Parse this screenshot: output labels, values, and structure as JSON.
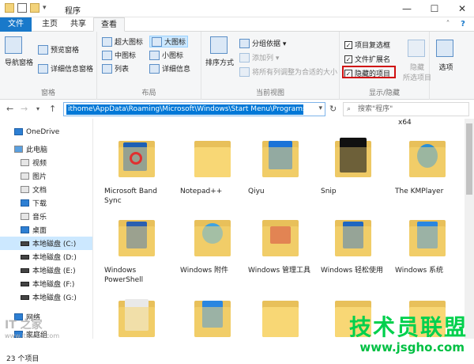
{
  "window": {
    "title": "程序",
    "minimize": "—",
    "maximize": "☐",
    "close": "✕",
    "help": "?"
  },
  "tabs": {
    "file": "文件",
    "home": "主页",
    "share": "共享",
    "view": "查看"
  },
  "ribbon": {
    "panes": {
      "nav_pane": "导航窗格",
      "preview": "预览窗格",
      "details": "详细信息窗格",
      "label": "窗格"
    },
    "layout": {
      "xlarge": "超大图标",
      "large": "大图标",
      "medium": "中图标",
      "small": "小图标",
      "list": "列表",
      "details": "详细信息",
      "label": "布局"
    },
    "current_view": {
      "sort": "排序方式",
      "group": "分组依据 ▾",
      "add_col": "添加列 ▾",
      "fit_cols": "将所有列调整为合适的大小",
      "label": "当前视图"
    },
    "show_hide": {
      "item_checkboxes": "项目复选框",
      "file_ext": "文件扩展名",
      "hidden_items": "隐藏的项目",
      "hide": "隐藏",
      "hide_selected": "所选项目",
      "label": "显示/隐藏",
      "options": "选项"
    }
  },
  "address": {
    "path": "ithome\\AppData\\Roaming\\Microsoft\\Windows\\Start Menu\\Programs",
    "search_placeholder": "搜索\"程序\""
  },
  "nav_pane": {
    "items": [
      "OneDrive",
      "此电脑",
      "视频",
      "图片",
      "文档",
      "下载",
      "音乐",
      "桌面",
      "本地磁盘 (C:)",
      "本地磁盘 (D:)",
      "本地磁盘 (E:)",
      "本地磁盘 (F:)",
      "本地磁盘 (G:)",
      "网络",
      "家庭组"
    ]
  },
  "folders": {
    "x64_label": "x64",
    "items": [
      "Microsoft Band Sync",
      "Notepad++",
      "Qiyu",
      "Snip",
      "The KMPlayer",
      "Windows PowerShell",
      "Windows 附件",
      "Windows 管理工具",
      "Windows 轻松使用",
      "Windows 系统"
    ]
  },
  "status": {
    "count": "23 个项目"
  },
  "watermark": {
    "text": "技术员联盟",
    "url": "www.jsgho.com",
    "it": "IT 之家",
    "it_url": "www.ithome.com"
  },
  "colors": {
    "accent": "#1979ca",
    "selection": "#cce8ff",
    "highlight_box": "#d01010",
    "watermark_green": "#00d04d"
  }
}
